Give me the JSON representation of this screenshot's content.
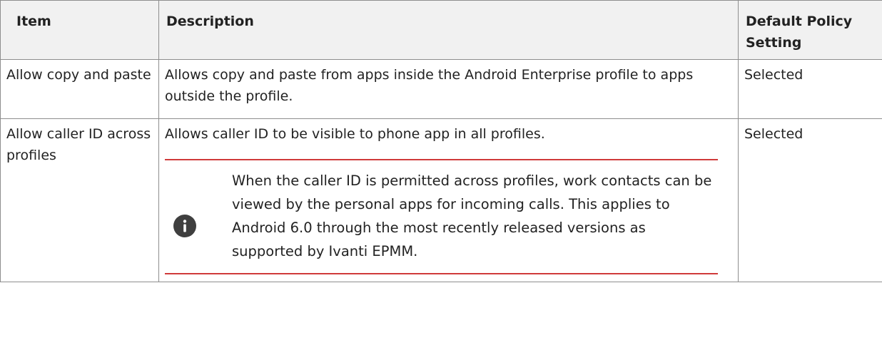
{
  "table": {
    "headers": {
      "item": "Item",
      "description": "Description",
      "default": "Default Policy Setting"
    },
    "rows": [
      {
        "item": "Allow copy and paste",
        "description": "Allows copy and paste from apps inside the Android Enterprise profile to apps outside the profile.",
        "default": "Selected"
      },
      {
        "item": "Allow caller ID across profiles",
        "description": "Allows caller ID to be visible to phone app in all profiles.",
        "note": "When the caller ID is permitted across profiles, work contacts can be viewed by the personal apps for incoming calls. This applies to Android 6.0 through the most recently released versions as supported by Ivanti EPMM.",
        "note_icon": "info-icon",
        "default": "Selected"
      }
    ]
  },
  "colors": {
    "header_bg": "#f1f1f1",
    "border": "#8e8e8e",
    "note_rule": "#d03a3a",
    "icon_bg": "#3f3f3f"
  }
}
